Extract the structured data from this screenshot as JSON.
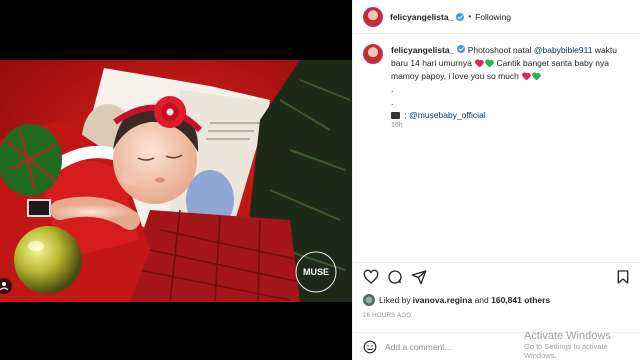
{
  "post": {
    "username": "felicyangelista_",
    "separator": "•",
    "follow_status": "Following",
    "caption": {
      "part1": "Photoshoot natal ",
      "mention1": "@babybible911",
      "part2": " waktu baru 14 hari umurnya ",
      "part3": " Cantik banget santa baby nya mamoy papoy, i love you so much ",
      "bullet1": ".",
      "bullet2": ".",
      "credit_sep": " : ",
      "mention2": "@musebaby_official"
    },
    "caption_time": "16h",
    "likes": {
      "prefix": "Liked by ",
      "user": "ivanova.regina",
      "and": " and ",
      "count": "160,841 others"
    },
    "posted_ago": "16 HOURS AGO",
    "comment_placeholder": "Add a comment...",
    "photo_watermark": "MUSE"
  },
  "overlay": {
    "line1": "Activate Windows",
    "line2": "Go to Settings to activate Windows."
  },
  "icons": [
    "verified-badge-icon",
    "heart-icon",
    "comment-icon",
    "share-icon",
    "bookmark-icon",
    "emoji-icon",
    "tag-user-icon",
    "clapperboard-icon"
  ],
  "colors": {
    "verified": "#3897f0",
    "mention": "#00376b",
    "heart_red": "#e0245e",
    "heart_green": "#2bb24c"
  }
}
